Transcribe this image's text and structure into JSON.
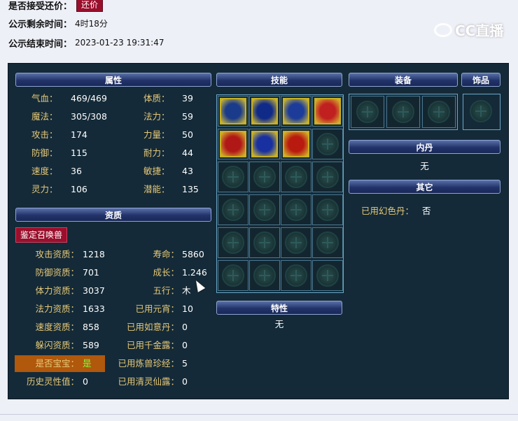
{
  "listing": {
    "accept_counter_label": "是否接受还价：",
    "counter_button": "还价",
    "remaining_label": "公示剩余时间：",
    "remaining_value": "4时18分",
    "end_label": "公示结束时间：",
    "end_value": "2023-01-23 19:31:47"
  },
  "watermark": "CC直播",
  "headers": {
    "attributes": "属性",
    "skills": "技能",
    "equipment": "装备",
    "accessory": "饰品",
    "inner_dan": "内丹",
    "aptitude": "资质",
    "traits": "特性",
    "other": "其它"
  },
  "attributes": [
    {
      "k": "气血：",
      "v": "469/469",
      "k2": "体质：",
      "v2": "39"
    },
    {
      "k": "魔法：",
      "v": "305/308",
      "k2": "法力：",
      "v2": "59"
    },
    {
      "k": "攻击：",
      "v": "174",
      "k2": "力量：",
      "v2": "50"
    },
    {
      "k": "防御：",
      "v": "115",
      "k2": "耐力：",
      "v2": "44"
    },
    {
      "k": "速度：",
      "v": "36",
      "k2": "敏捷：",
      "v2": "43"
    },
    {
      "k": "灵力：",
      "v": "106",
      "k2": "潜能：",
      "v2": "135"
    }
  ],
  "identify_button": "鉴定召唤兽",
  "aptitude": [
    {
      "k": "攻击资质：",
      "v": "1218",
      "k2": "寿命：",
      "v2": "5860"
    },
    {
      "k": "防御资质：",
      "v": "701",
      "k2": "成长：",
      "v2": "1.246"
    },
    {
      "k": "体力资质：",
      "v": "3037",
      "k2": "五行：",
      "v2": "木"
    },
    {
      "k": "法力资质：",
      "v": "1633",
      "k2": "已用元宵：",
      "v2": "10"
    },
    {
      "k": "速度资质：",
      "v": "858",
      "k2": "已用如意丹：",
      "v2": "0"
    },
    {
      "k": "躲闪资质：",
      "v": "589",
      "k2": "已用千金露：",
      "v2": "0"
    },
    {
      "k": "是否宝宝：",
      "v": "是",
      "k2": "已用炼兽珍经：",
      "v2": "5"
    },
    {
      "k": "历史灵性值：",
      "v": "0",
      "k2": "已用清灵仙露：",
      "v2": "0"
    }
  ],
  "inner_dan_value": "无",
  "traits_value": "无",
  "other": {
    "label": "已用幻色丹：",
    "value": "否"
  },
  "skill_icons": [
    {
      "name": "wheel-skill-icon",
      "color": "#1a3a8a"
    },
    {
      "name": "figure-skill-icon",
      "color": "#102a88"
    },
    {
      "name": "sparkle-skill-icon",
      "color": "#1d3c9a"
    },
    {
      "name": "rune-skill-icon",
      "color": "#c02020"
    },
    {
      "name": "skeleton-skill-icon",
      "color": "#b01818"
    },
    {
      "name": "lightning-skill-icon",
      "color": "#1830a0"
    },
    {
      "name": "flame-skill-icon",
      "color": "#b81a10"
    }
  ]
}
